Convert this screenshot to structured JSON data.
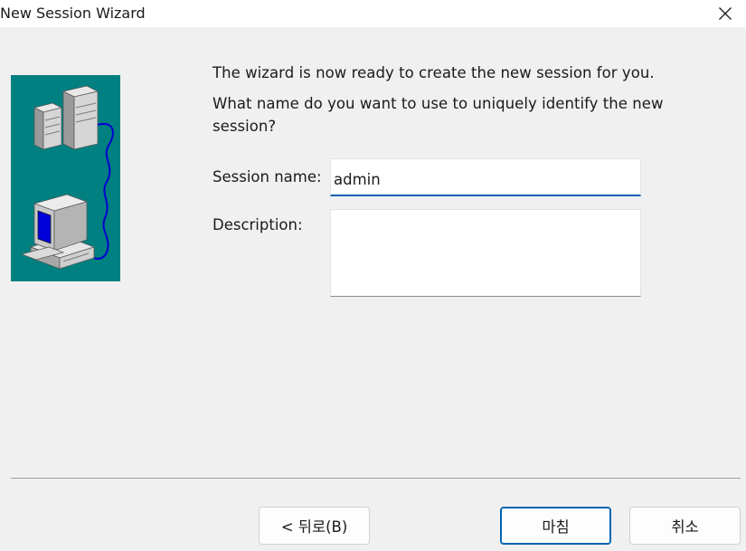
{
  "window": {
    "title": "New Session Wizard",
    "close_glyph": "✕"
  },
  "wizard": {
    "line1": "The wizard is now ready to create the new session for you.",
    "line2": "What name do you want to use to uniquely identify the new",
    "line3": "session?"
  },
  "form": {
    "session_name_label": "Session name:",
    "session_name_value": "admin",
    "description_label": "Description:",
    "description_value": ""
  },
  "buttons": {
    "back_label": "< 뒤로(B)",
    "finish_label": "마침",
    "cancel_label": "취소"
  },
  "colors": {
    "image_background": "#008080",
    "focus_accent": "#0063b1",
    "window_background": "#f0f0f0"
  },
  "icons": {
    "title_close": "close-icon",
    "wizard_art": "network-computers-icon"
  }
}
